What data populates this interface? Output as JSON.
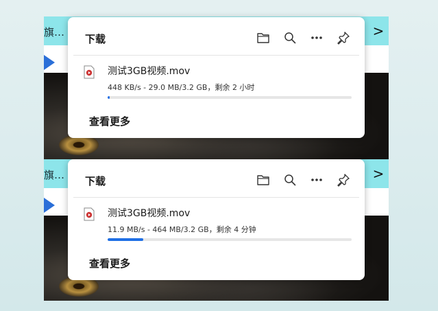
{
  "background": {
    "left_tab_text": "旗…",
    "chevron": ">"
  },
  "panels": [
    {
      "title": "下载",
      "icons": [
        "folder-icon",
        "search-icon",
        "more-icon",
        "pin-icon"
      ],
      "item": {
        "filename": "测试3GB视频.mov",
        "status": "448 KB/s - 29.0 MB/3.2 GB，剩余 2 小时",
        "progress": 0.009
      },
      "see_more": "查看更多"
    },
    {
      "title": "下载",
      "icons": [
        "folder-icon",
        "search-icon",
        "more-icon",
        "pin-icon"
      ],
      "item": {
        "filename": "测试3GB视频.mov",
        "status": "11.9 MB/s - 464 MB/3.2 GB，剩余 4 分钟",
        "progress": 0.145
      },
      "see_more": "查看更多"
    }
  ],
  "colors": {
    "accent": "#1f6fe5",
    "tab_bar": "#8de5ea"
  }
}
